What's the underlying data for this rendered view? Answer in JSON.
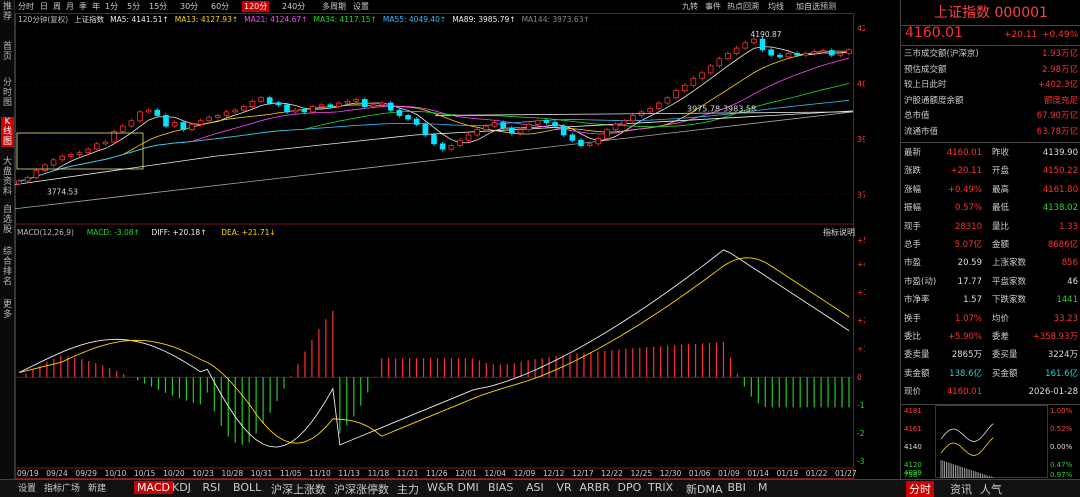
{
  "left_tabs": [
    "推荐",
    "首页",
    "分时图",
    "K线图",
    "大盘资料",
    "自选股",
    "综合排名",
    "更多"
  ],
  "toolbar_left": [
    "分时",
    "日",
    "周",
    "月",
    "季",
    "年",
    "1分",
    "5分",
    "15分",
    "30分",
    "60分",
    "120分",
    "240分",
    "多周期",
    "设置"
  ],
  "toolbar_active": "120分",
  "toolbar_right": [
    "九转",
    "事件",
    "热点回溯",
    "均线",
    "加自选",
    "预测"
  ],
  "ma_legend": [
    {
      "text": "120分钟(复权)",
      "color": "#bbbbbb"
    },
    {
      "text": "上证指数",
      "color": "#dddddd"
    },
    {
      "text": "MA5: 4141.51↑",
      "color": "#eeeeee"
    },
    {
      "text": "MA13: 4127.93↑",
      "color": "#ffd700"
    },
    {
      "text": "MA21: 4124.67↑",
      "color": "#ff44ff"
    },
    {
      "text": "MA34: 4117.15↑",
      "color": "#22dd22"
    },
    {
      "text": "MA55: 4049.40↑",
      "color": "#33bbff"
    },
    {
      "text": "MA89: 3985.79↑",
      "color": "#eeeeee"
    },
    {
      "text": "MA144: 3973.63↑",
      "color": "#888888"
    }
  ],
  "price_axis": [
    "4222",
    "4065",
    "3909",
    "3752"
  ],
  "annotations": {
    "high": "4190.87",
    "low": "3774.53",
    "gap": "3975.78-3983.58"
  },
  "macd_legend": [
    {
      "text": "MACD(12,26,9)",
      "color": "#bbbbbb"
    },
    {
      "text": "MACD: -3.08↑",
      "color": "#22dd22"
    },
    {
      "text": "DIFF: +20.18↑",
      "color": "#eeeeee"
    },
    {
      "text": "DEA: +21.71↓",
      "color": "#ffd700"
    }
  ],
  "indicator_help": "指标说明",
  "macd_axis": [
    "+58.91",
    "+48.67",
    "+36.63",
    "+24.58",
    "+12.23",
    "0",
    "-11.87",
    "-23.91",
    "-35.96"
  ],
  "date_axis": [
    "09/19",
    "09/24",
    "09/29",
    "10/10",
    "10/15",
    "10/20",
    "10/23",
    "10/28",
    "10/31",
    "11/05",
    "11/10",
    "11/13",
    "11/18",
    "11/21",
    "11/26",
    "12/01",
    "12/04",
    "12/09",
    "12/12",
    "12/17",
    "12/22",
    "12/25",
    "12/30",
    "01/06",
    "01/09",
    "01/14",
    "01/19",
    "01/22",
    "01/27"
  ],
  "right": {
    "title": "上证指数 000001",
    "price": "4160.01",
    "change": "+20.11",
    "change_pct": "+0.49%",
    "info": [
      {
        "k": "三市成交额(沪深京)",
        "v": "1.93万亿",
        "c": "red"
      },
      {
        "k": "预估成交额",
        "v": "2.98万亿",
        "c": "red"
      },
      {
        "k": "较上日此时",
        "v": "+402.3亿",
        "c": "red"
      },
      {
        "k": "沪股通额度余额",
        "v": "额度充足",
        "c": "red"
      },
      {
        "k": "总市值",
        "v": "67.90万亿",
        "c": "red"
      },
      {
        "k": "流通市值",
        "v": "63.78万亿",
        "c": "red"
      }
    ],
    "quotes": [
      {
        "a": "最新",
        "b": "4160.01",
        "bc": "red",
        "c": "昨收",
        "d": "4139.90",
        "dc": "wht"
      },
      {
        "a": "涨跌",
        "b": "+20.11",
        "bc": "red",
        "c": "开盘",
        "d": "4150.22",
        "dc": "red"
      },
      {
        "a": "涨幅",
        "b": "+0.49%",
        "bc": "red",
        "c": "最高",
        "d": "4161.80",
        "dc": "red"
      },
      {
        "a": "振幅",
        "b": "0.57%",
        "bc": "red",
        "c": "最低",
        "d": "4138.02",
        "dc": "grn"
      },
      {
        "a": "现手",
        "b": "28310",
        "bc": "red",
        "c": "量比",
        "d": "1.33",
        "dc": "red"
      },
      {
        "a": "总手",
        "b": "5.07亿",
        "bc": "red",
        "c": "金额",
        "d": "8686亿",
        "dc": "red"
      },
      {
        "a": "市盈",
        "b": "20.59",
        "bc": "wht",
        "c": "上涨家数",
        "d": "856",
        "dc": "red"
      },
      {
        "a": "市盈(动)",
        "b": "17.77",
        "bc": "wht",
        "c": "平盘家数",
        "d": "46",
        "dc": "wht"
      },
      {
        "a": "市净率",
        "b": "1.57",
        "bc": "wht",
        "c": "下跌家数",
        "d": "1441",
        "dc": "grn"
      },
      {
        "a": "换手",
        "b": "1.07%",
        "bc": "red",
        "c": "均价",
        "d": "33.23",
        "dc": "red"
      },
      {
        "a": "委比",
        "b": "+5.90%",
        "bc": "red",
        "c": "委差",
        "d": "+358.93万",
        "dc": "red"
      },
      {
        "a": "委卖量",
        "b": "2865万",
        "bc": "wht",
        "c": "委买量",
        "d": "3224万",
        "dc": "wht"
      },
      {
        "a": "卖金额",
        "b": "138.6亿",
        "bc": "cyn",
        "c": "买金额",
        "d": "161.6亿",
        "dc": "cyn"
      },
      {
        "a": "现价",
        "b": "4160.01",
        "bc": "red",
        "c": "",
        "d": "2026-01-28",
        "dc": "wht"
      }
    ],
    "mini_axis_left": [
      "4181",
      "4161",
      "4140",
      "4120",
      "4099",
      "756"
    ],
    "mini_axis_right": [
      "1.00%",
      "0.52%",
      "0.00%",
      "0.47%",
      "0.97%"
    ]
  },
  "bottom_tabs": [
    "设置",
    "指标广场",
    "新建",
    "MACD",
    "KDJ",
    "RSI",
    "BOLL",
    "沪深上涨数",
    "沪深涨停数",
    "主力",
    "W&R",
    "DMI",
    "BIAS",
    "ASI",
    "VR",
    "ARBR",
    "DPO",
    "TRIX",
    "新DMA",
    "BBI",
    "M"
  ],
  "bottom_active": "MACD",
  "bottom_right": [
    "分时",
    "资讯",
    "人气"
  ],
  "chart_data": {
    "type": "candlestick",
    "title": "上证指数",
    "x_label_first": "09/19",
    "x_label_last": "01/27",
    "y_range": [
      3700,
      4230
    ],
    "annotated_high": 4190.87,
    "annotated_low": 3774.53,
    "close_path": [
      3790,
      3800,
      3820,
      3835,
      3850,
      3860,
      3865,
      3870,
      3880,
      3895,
      3900,
      3930,
      3945,
      3960,
      3985,
      3990,
      3975,
      3945,
      3955,
      3935,
      3950,
      3960,
      3970,
      3975,
      3985,
      3990,
      4000,
      4015,
      4025,
      4010,
      4005,
      3985,
      3990,
      3985,
      4000,
      4005,
      4000,
      4010,
      4015,
      4020,
      4000,
      4005,
      4010,
      3990,
      3975,
      3965,
      3950,
      3920,
      3895,
      3880,
      3890,
      3905,
      3920,
      3935,
      3945,
      3955,
      3940,
      3925,
      3935,
      3950,
      3960,
      3955,
      3945,
      3920,
      3905,
      3890,
      3895,
      3910,
      3935,
      3950,
      3960,
      3975,
      3985,
      3995,
      4010,
      4025,
      4045,
      4060,
      4080,
      4095,
      4115,
      4135,
      4150,
      4165,
      4180,
      4190,
      4160,
      4145,
      4140,
      4150,
      4145,
      4150,
      4155,
      4158,
      4145,
      4150,
      4160
    ],
    "macd_hist_range": [
      -35.96,
      58.91
    ]
  }
}
